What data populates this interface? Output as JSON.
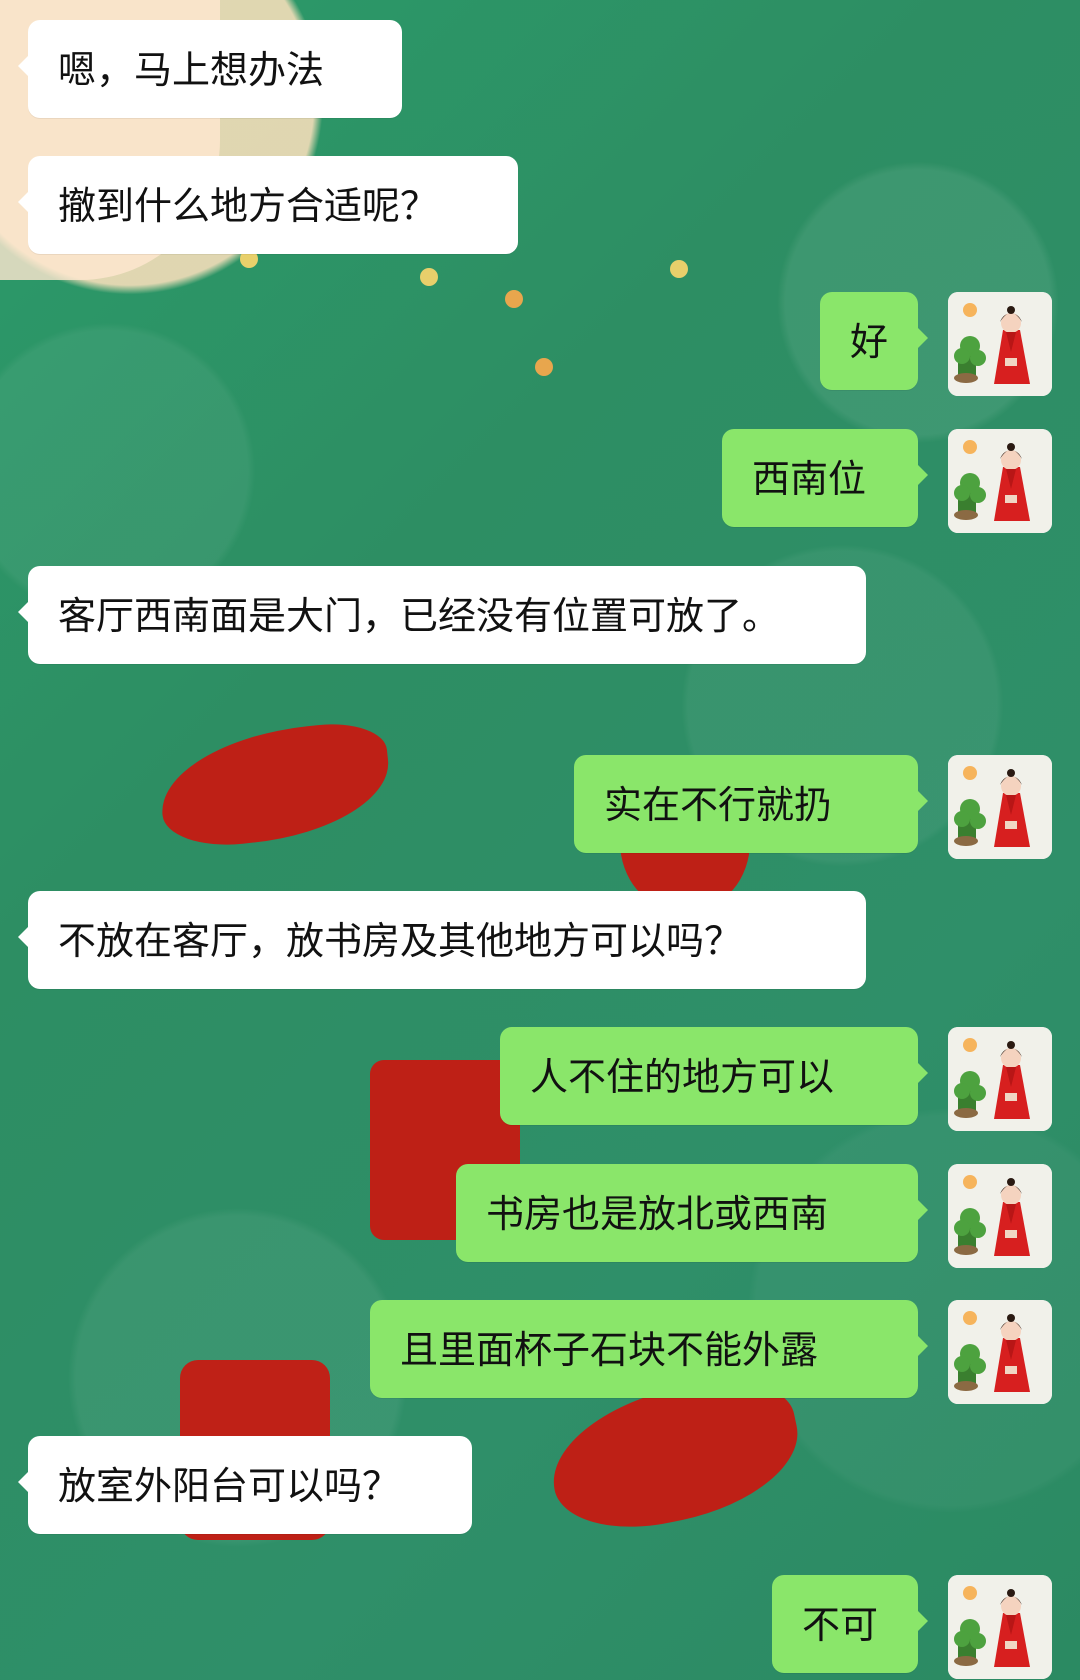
{
  "chat": {
    "messages": [
      {
        "side": "left",
        "text": "嗯，马上想办法"
      },
      {
        "side": "left",
        "text": "撤到什么地方合适呢？"
      },
      {
        "side": "right",
        "text": "好"
      },
      {
        "side": "right",
        "text": "西南位"
      },
      {
        "side": "left",
        "text": "客厅西南面是大门，已经没有位置可放了。"
      },
      {
        "side": "right",
        "text": "实在不行就扔"
      },
      {
        "side": "left",
        "text": "不放在客厅，放书房及其他地方可以吗？"
      },
      {
        "side": "right",
        "text": "人不住的地方可以"
      },
      {
        "side": "right",
        "text": "书房也是放北或西南"
      },
      {
        "side": "right",
        "text": "且里面杯子石块不能外露"
      },
      {
        "side": "left",
        "text": "放室外阳台可以吗？"
      },
      {
        "side": "right",
        "text": "不可"
      }
    ]
  },
  "theme": {
    "chat_background": "#2f8f62",
    "incoming_bubble": "#ffffff",
    "outgoing_bubble": "#8ae66a",
    "text_color": "#111111"
  }
}
